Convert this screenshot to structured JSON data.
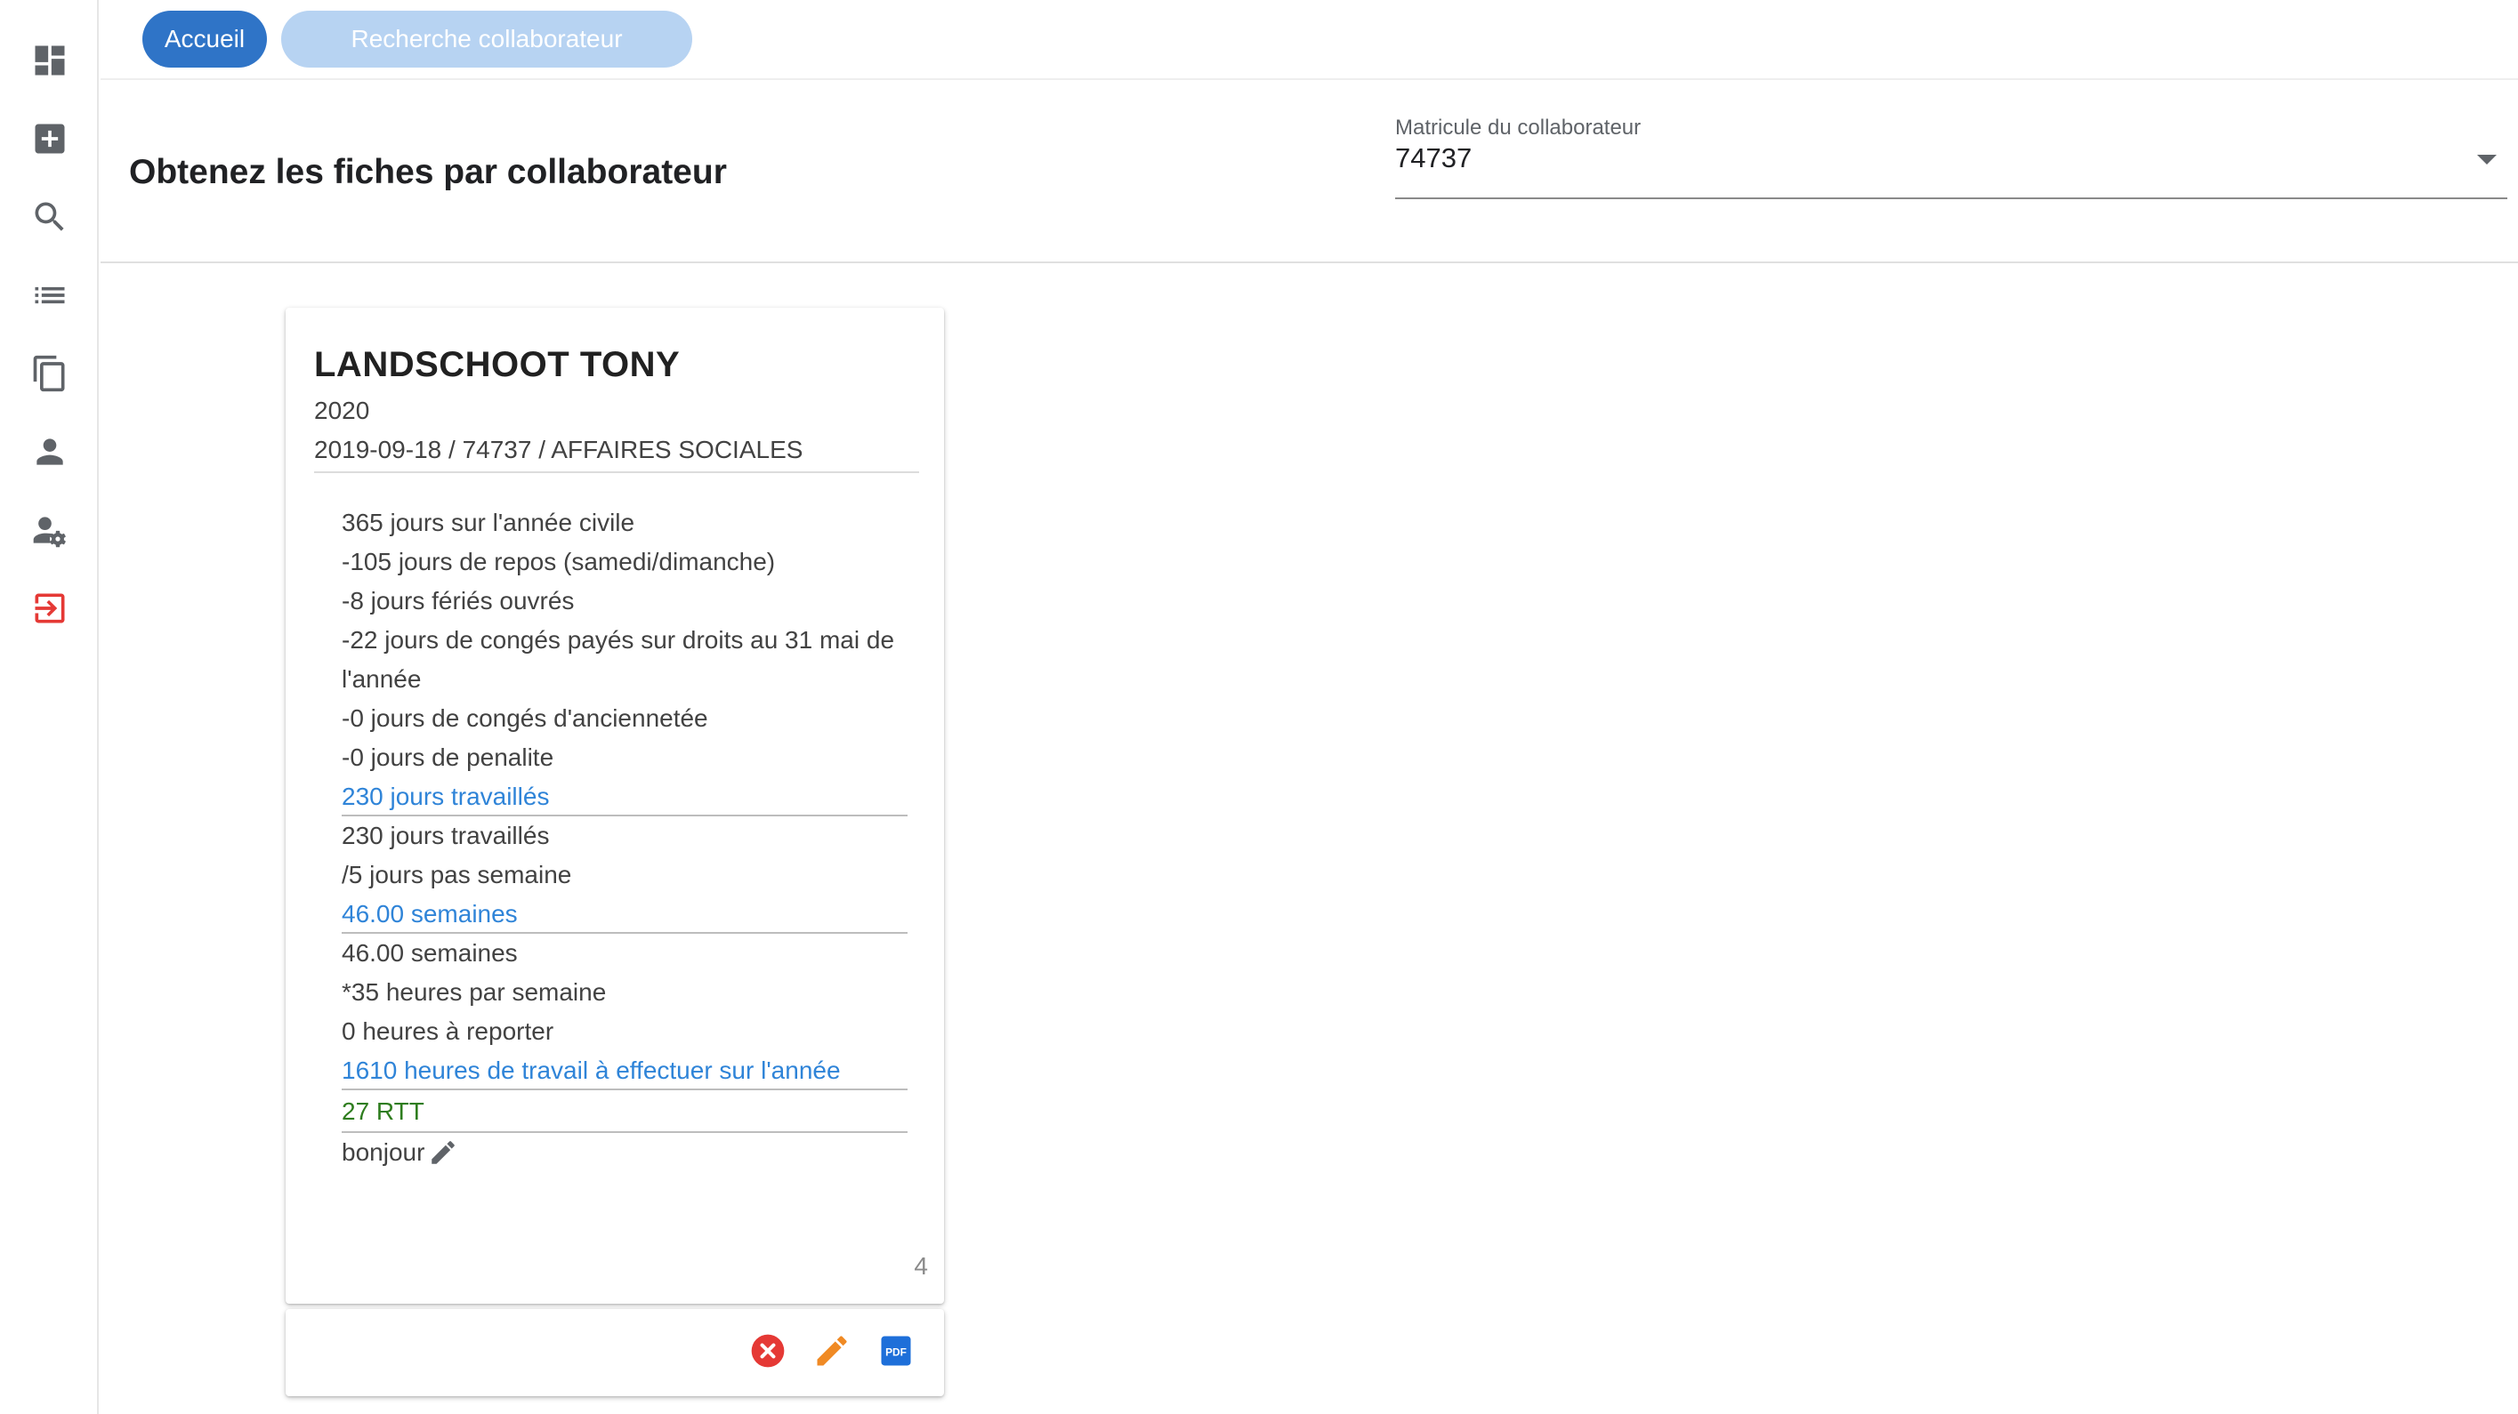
{
  "sidebar": {
    "icons": [
      "dashboard-icon",
      "add-box-icon",
      "search-icon",
      "list-icon",
      "copy-icon",
      "person-icon",
      "person-settings-icon",
      "logout-icon"
    ]
  },
  "topbar": {
    "home_label": "Accueil",
    "search_label": "Recherche collaborateur"
  },
  "header": {
    "title": "Obtenez les fiches par collaborateur",
    "select_label": "Matricule du collaborateur",
    "select_value": "74737"
  },
  "card": {
    "name": "LANDSCHOOT TONY",
    "year": "2020",
    "meta": "2019-09-18 / 74737 / AFFAIRES SOCIALES",
    "lines": {
      "days_year": "365 jours sur l'année civile",
      "rest_days": "-105 jours de repos (samedi/dimanche)",
      "holidays": "-8 jours fériés ouvrés",
      "paid_leave": "-22 jours de congés payés sur droits au 31 mai de l'année",
      "seniority": "-0 jours de congés d'anciennetée",
      "penalty": "-0 jours de penalite",
      "worked_days_total": "230 jours travaillés",
      "worked_days": "230 jours travaillés",
      "days_per_week": "/5 jours pas semaine",
      "weeks_total": "46.00 semaines",
      "weeks": "46.00 semaines",
      "hours_per_week": "*35 heures par semaine",
      "carry_over": "0 heures à reporter",
      "hours_total": "1610 heures de travail à effectuer sur l'année",
      "rtt": "27 RTT",
      "note": "bonjour"
    },
    "count": "4"
  },
  "colors": {
    "primary": "#2f74c7",
    "link_blue": "#2f84d8",
    "green": "#2e7d1e",
    "danger": "#e53935",
    "edit_orange": "#f08a24",
    "pdf_blue": "#1e6fd9"
  }
}
